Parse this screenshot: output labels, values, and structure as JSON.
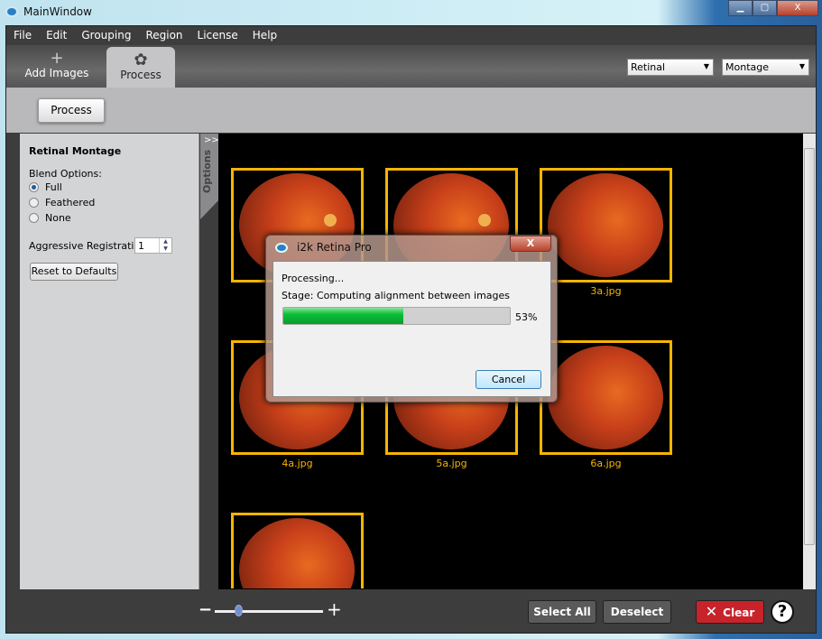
{
  "window": {
    "title": "MainWindow",
    "controls": [
      "minimize",
      "maximize",
      "close"
    ]
  },
  "menu": [
    "File",
    "Edit",
    "Grouping",
    "Region",
    "License",
    "Help"
  ],
  "tabs": [
    {
      "label": "Add Images",
      "icon": "plus-icon"
    },
    {
      "label": "Process",
      "icon": "gear-icon",
      "active": true
    }
  ],
  "selects": {
    "type": "Retinal",
    "mode": "Montage"
  },
  "process_button": "Process",
  "options": {
    "tab_label": "Options",
    "collapse_glyph": ">>",
    "title": "Retinal Montage",
    "blend_label": "Blend Options:",
    "blend": [
      {
        "label": "Full",
        "checked": true
      },
      {
        "label": "Feathered",
        "checked": false
      },
      {
        "label": "None",
        "checked": false
      }
    ],
    "aggressive_label": "Aggressive Registration:",
    "aggressive_value": "1",
    "reset_label": "Reset to Defaults"
  },
  "thumbnails": [
    {
      "label": ""
    },
    {
      "label": ""
    },
    {
      "label": "3a.jpg"
    },
    {
      "label": "4a.jpg"
    },
    {
      "label": "5a.jpg"
    },
    {
      "label": "6a.jpg"
    },
    {
      "label": ""
    }
  ],
  "colors": {
    "selection": "#f6b500",
    "clear": "#c8232a",
    "progress": "#08c038"
  },
  "bottom": {
    "zoom_level": 0.2,
    "select_all": "Select All",
    "deselect": "Deselect",
    "clear": "Clear",
    "help": "?"
  },
  "dialog": {
    "title": "i2k Retina Pro",
    "close": "X",
    "status": "Processing...",
    "stage": "Stage:  Computing alignment between images",
    "progress": 53,
    "progress_text": "53%",
    "cancel": "Cancel"
  }
}
